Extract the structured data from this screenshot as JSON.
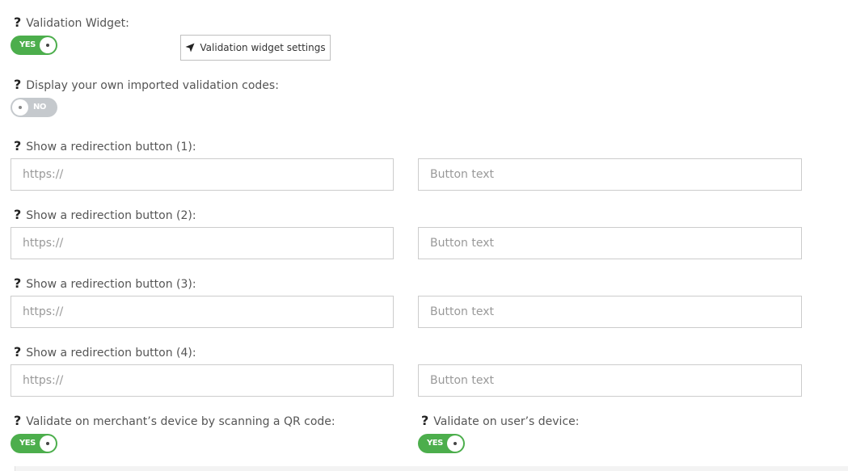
{
  "validation_widget": {
    "label": "Validation Widget:",
    "toggle": "YES",
    "settings_button": "Validation widget settings"
  },
  "imported_codes": {
    "label": "Display your own imported validation codes:",
    "toggle": "NO"
  },
  "redirections": [
    {
      "label": "Show a redirection button (1):",
      "url_placeholder": "https://",
      "text_placeholder": "Button text"
    },
    {
      "label": "Show a redirection button (2):",
      "url_placeholder": "https://",
      "text_placeholder": "Button text"
    },
    {
      "label": "Show a redirection button (3):",
      "url_placeholder": "https://",
      "text_placeholder": "Button text"
    },
    {
      "label": "Show a redirection button (4):",
      "url_placeholder": "https://",
      "text_placeholder": "Button text"
    }
  ],
  "merchant_device": {
    "label": "Validate on merchant’s device by scanning a QR code:",
    "toggle": "YES"
  },
  "user_device": {
    "label": "Validate on user’s device:",
    "toggle": "YES"
  },
  "help_glyph": "?",
  "colors": {
    "toggle_on": "#4cae4c",
    "toggle_off": "#c5c9cd"
  }
}
